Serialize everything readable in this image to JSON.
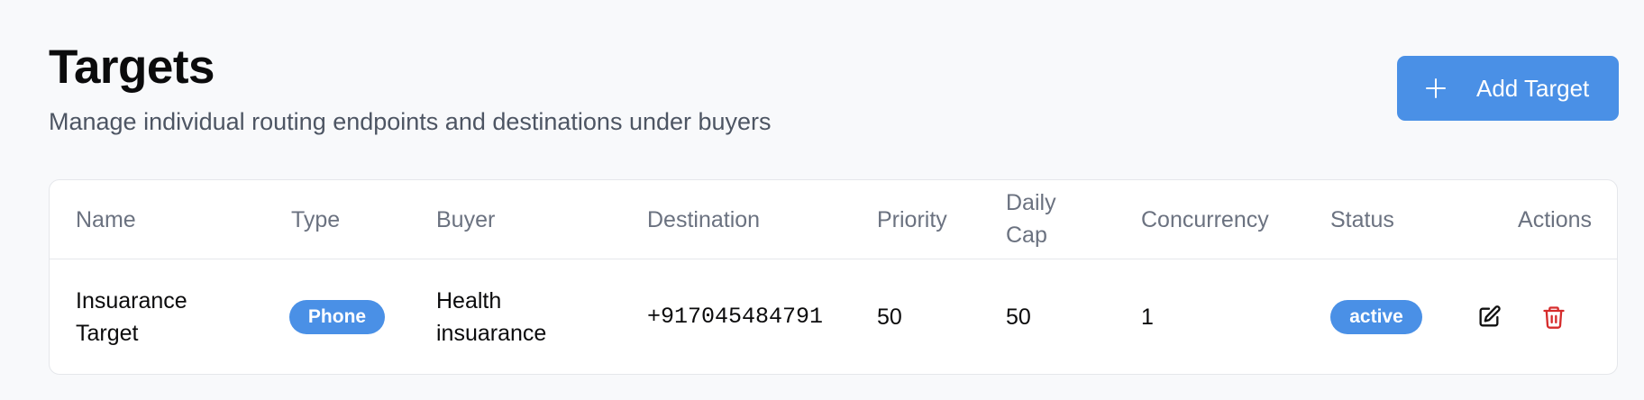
{
  "header": {
    "title": "Targets",
    "subtitle": "Manage individual routing endpoints and destinations under buyers",
    "add_button_label": "Add Target"
  },
  "table": {
    "columns": {
      "name": "Name",
      "type": "Type",
      "buyer": "Buyer",
      "destination": "Destination",
      "priority": "Priority",
      "daily_cap": "Daily Cap",
      "concurrency": "Concurrency",
      "status": "Status",
      "actions": "Actions"
    },
    "rows": [
      {
        "name": "Insuarance Target",
        "type": "Phone",
        "buyer": "Health insuarance",
        "destination": "+917045484791",
        "priority": "50",
        "daily_cap": "50",
        "concurrency": "1",
        "status": "active"
      }
    ]
  },
  "icons": {
    "add": "plus-icon",
    "edit": "edit-icon",
    "delete": "trash-icon"
  },
  "colors": {
    "accent": "#4a90e6",
    "danger": "#d62c2c",
    "background": "#f8f9fb",
    "muted_text": "#6b7280"
  }
}
